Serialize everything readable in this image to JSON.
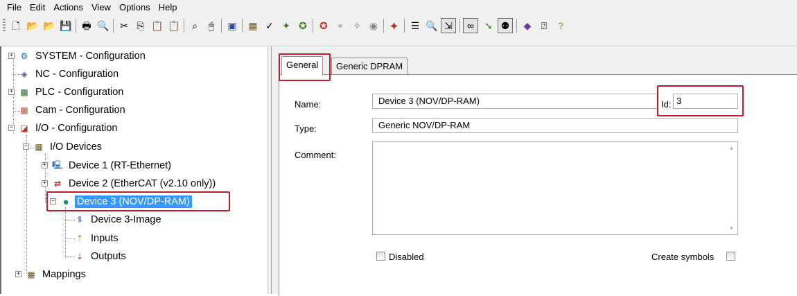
{
  "menu": {
    "items": [
      "File",
      "Edit",
      "Actions",
      "View",
      "Options",
      "Help"
    ]
  },
  "toolbar": {
    "icons": [
      "new-file",
      "open-folder",
      "open-recent",
      "save",
      "print",
      "print-preview",
      "cut",
      "copy",
      "paste",
      "paste-special",
      "find",
      "mouse",
      "target-system",
      "activate-config",
      "check",
      "config-mode",
      "run-mode",
      "restart",
      "scope",
      "watch",
      "link",
      "calc",
      "search",
      "zoom",
      "variable-link",
      "glasses",
      "green-arrow",
      "show-online",
      "book",
      "help",
      "question"
    ]
  },
  "tree": {
    "items": [
      {
        "label": "SYSTEM - Configuration"
      },
      {
        "label": "NC - Configuration"
      },
      {
        "label": "PLC - Configuration"
      },
      {
        "label": "Cam - Configuration"
      },
      {
        "label": "I/O - Configuration"
      },
      {
        "label": "I/O Devices"
      },
      {
        "label": "Device 1 (RT-Ethernet)"
      },
      {
        "label": "Device 2 (EtherCAT (v2.10 only))"
      },
      {
        "label": "Device 3 (NOV/DP-RAM)"
      },
      {
        "label": "Device 3-Image"
      },
      {
        "label": "Inputs"
      },
      {
        "label": "Outputs"
      },
      {
        "label": "Mappings"
      }
    ]
  },
  "tabs": [
    {
      "label": "General"
    },
    {
      "label": "Generic DPRAM"
    }
  ],
  "general": {
    "name_label": "Name:",
    "name_value": "Device 3 (NOV/DP-RAM)",
    "id_label": "Id:",
    "id_value": "3",
    "type_label": "Type:",
    "type_value": "Generic NOV/DP-RAM",
    "comment_label": "Comment:",
    "comment_value": "",
    "disabled_label": "Disabled",
    "disabled_checked": false,
    "create_symbols_label": "Create symbols",
    "create_symbols_checked": false
  },
  "colors": {
    "highlight": "#b81e2b",
    "selection": "#3399ff"
  }
}
